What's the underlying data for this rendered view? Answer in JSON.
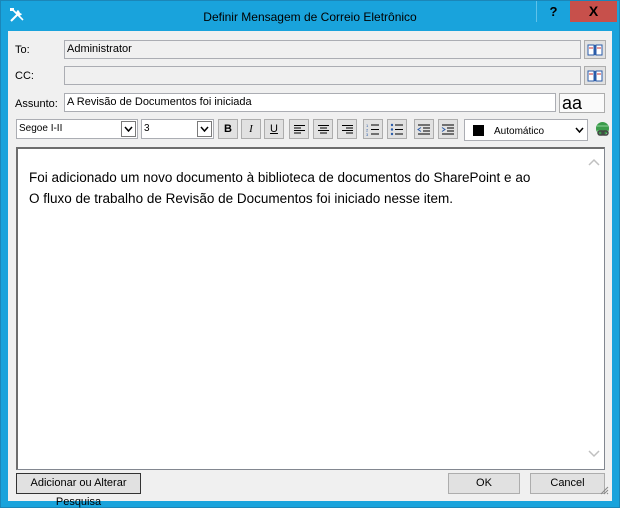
{
  "window": {
    "title": "Definir Mensagem de Correio Eletrônico",
    "help_label": "?",
    "close_label": "X"
  },
  "fields": {
    "to": {
      "label": "To:",
      "value": "Administrator"
    },
    "cc": {
      "label": "CC:",
      "value": ""
    },
    "subject": {
      "label": "Assunto:",
      "value": "A Revisão de Documentos foi iniciada"
    },
    "aa_label": "aa"
  },
  "toolbar": {
    "font": "Segoe I-II",
    "size": "3",
    "bold": "B",
    "italic": "I",
    "underline": "U",
    "color_label": "Automático",
    "color_value": "#000000"
  },
  "editor": {
    "line1": "Foi adicionado um novo documento à biblioteca de documentos do SharePoint e ao",
    "line2": "O fluxo de trabalho de Revisão de Documentos foi iniciado nesse item."
  },
  "buttons": {
    "search": "Adicionar ou Alterar Pesquisa",
    "ok": "OK",
    "cancel": "Cancel"
  }
}
